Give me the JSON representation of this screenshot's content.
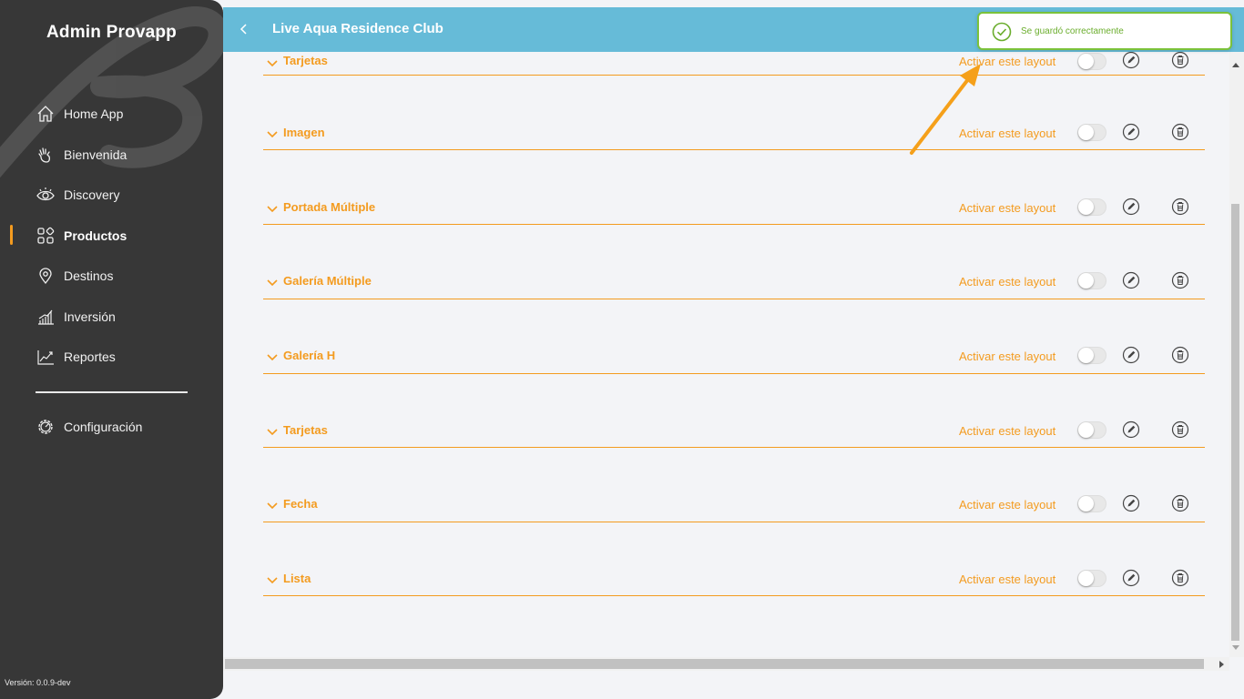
{
  "sidebar": {
    "brand": "Admin Provapp",
    "items": [
      {
        "label": "Home App",
        "icon": "home-icon"
      },
      {
        "label": "Bienvenida",
        "icon": "waving-hand-icon"
      },
      {
        "label": "Discovery",
        "icon": "eye-icon"
      },
      {
        "label": "Productos",
        "icon": "grid-icon",
        "active": true
      },
      {
        "label": "Destinos",
        "icon": "map-pin-icon"
      },
      {
        "label": "Inversión",
        "icon": "bar-chart-icon"
      },
      {
        "label": "Reportes",
        "icon": "line-chart-icon"
      }
    ],
    "config": {
      "label": "Configuración",
      "icon": "gear-icon"
    },
    "version": "Versión: 0.0.9-dev"
  },
  "header": {
    "title": "Live Aqua Residence Club"
  },
  "toast": {
    "message": "Se guardó correctamente"
  },
  "layouts": {
    "activate_label": "Activar este layout",
    "rows": [
      {
        "name": "Tarjetas"
      },
      {
        "name": "Imagen"
      },
      {
        "name": "Portada Múltiple"
      },
      {
        "name": "Galería Múltiple"
      },
      {
        "name": "Galería H"
      },
      {
        "name": "Tarjetas"
      },
      {
        "name": "Fecha"
      },
      {
        "name": "Lista"
      }
    ]
  },
  "colors": {
    "sidebar_bg": "#373737",
    "header_bg": "#66bbd8",
    "accent": "#f39b1f",
    "success": "#7bc23a"
  }
}
